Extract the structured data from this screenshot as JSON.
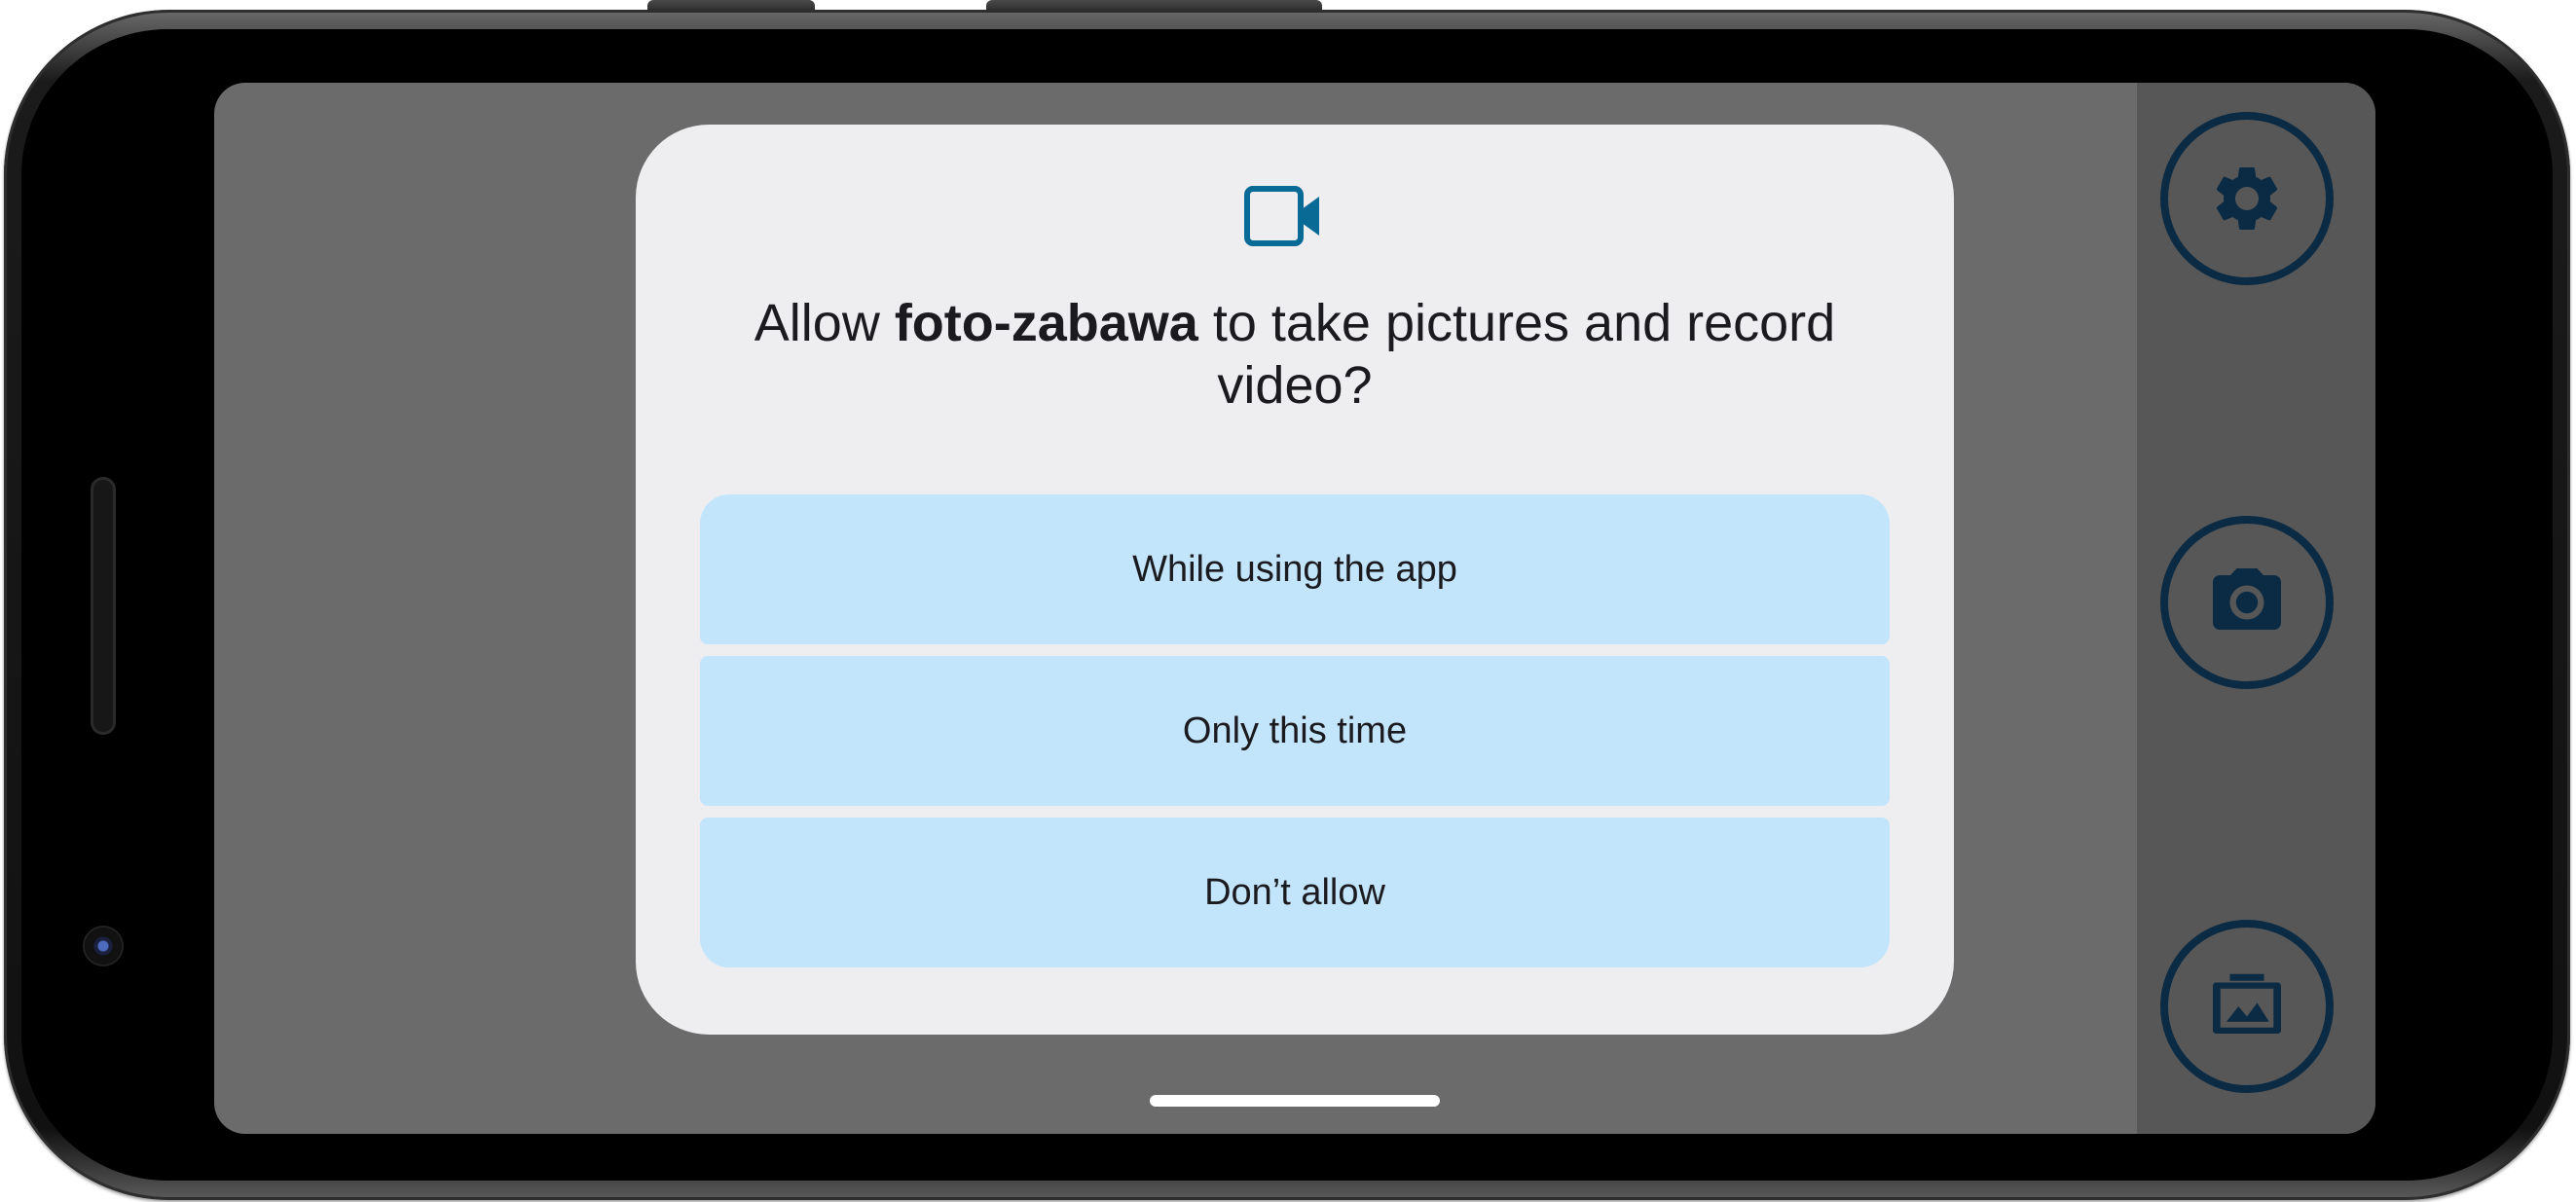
{
  "dialog": {
    "icon": "video-camera-icon",
    "title_prefix": "Allow ",
    "app_name": "foto-zabawa",
    "title_suffix": " to take pictures and record video?",
    "options": [
      {
        "label": "While using the app"
      },
      {
        "label": "Only this time"
      },
      {
        "label": "Don’t allow"
      }
    ]
  },
  "side_panel": {
    "buttons": [
      {
        "icon": "settings-gear-icon"
      },
      {
        "icon": "camera-shutter-icon"
      },
      {
        "icon": "gallery-icon"
      }
    ]
  },
  "colors": {
    "screen_background": "#6b6b6b",
    "side_panel_background": "#575757",
    "dialog_background": "#eeeef1",
    "option_background": "#c3e5fb",
    "accent_icon": "#0a6a96",
    "side_button_color": "#0b2a43"
  }
}
